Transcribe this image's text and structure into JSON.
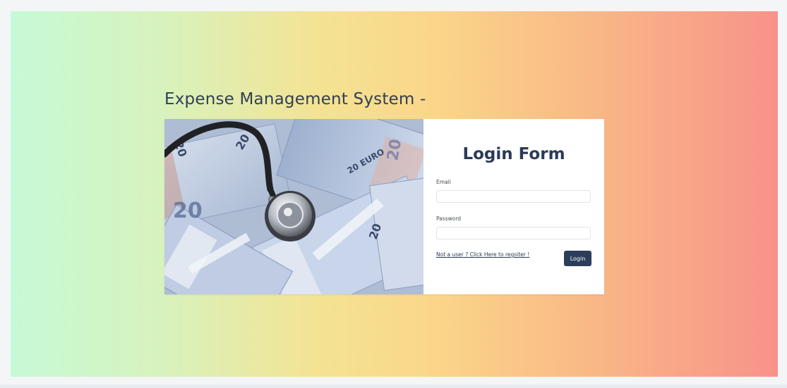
{
  "app": {
    "title": "Expense Management System -"
  },
  "hero_image": {
    "description_icon": "stethoscope-on-euro-banknotes-image",
    "banknote_label": "20 EURO",
    "banknote_number": "20"
  },
  "login_form": {
    "title": "Login Form",
    "email_label": "Email",
    "email_value": "",
    "password_label": "Password",
    "password_value": "",
    "register_link": "Not a user ? Click Here to regsiter !",
    "login_button": "Login"
  },
  "colors": {
    "primary": "#2c3e5c",
    "title_text": "#2f4057",
    "gradient_start": "#c6fad6",
    "gradient_mid": "#f4e393",
    "gradient_end": "#f8928a"
  }
}
